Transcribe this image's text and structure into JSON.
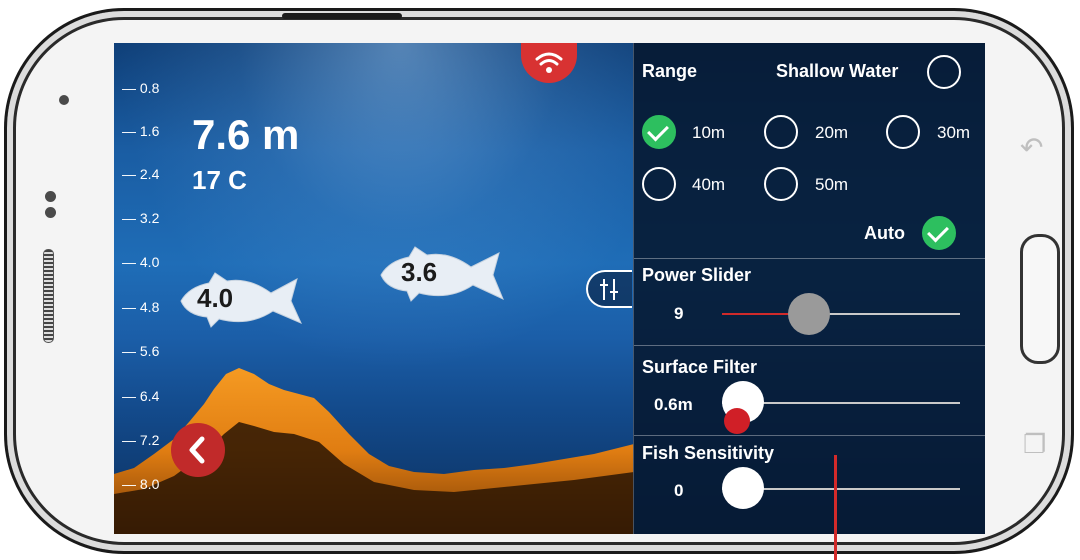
{
  "depth_scale": [
    "0.8",
    "1.6",
    "2.4",
    "3.2",
    "4.0",
    "4.8",
    "5.6",
    "6.4",
    "7.2",
    "8.0"
  ],
  "readout": {
    "depth": "7.6 m",
    "temperature": "17 C"
  },
  "fish": [
    {
      "label": "4.0"
    },
    {
      "label": "3.6"
    }
  ],
  "panel": {
    "range_title": "Range",
    "shallow_water_label": "Shallow Water",
    "shallow_water_checked": false,
    "range_options": [
      {
        "label": "10m",
        "checked": true
      },
      {
        "label": "20m",
        "checked": false
      },
      {
        "label": "30m",
        "checked": false
      },
      {
        "label": "40m",
        "checked": false
      },
      {
        "label": "50m",
        "checked": false
      }
    ],
    "auto_label": "Auto",
    "auto_checked": true,
    "power": {
      "title": "Power Slider",
      "value": "9",
      "fraction": 0.32
    },
    "surface": {
      "title": "Surface Filter",
      "value": "0.6m",
      "fraction": 0.0
    },
    "sensitivity": {
      "title": "Fish Sensitivity",
      "value": "0",
      "fraction": 0.0
    }
  },
  "icons": {
    "wifi": "wifi-icon",
    "back": "chevron-left-icon",
    "settings_toggle": "sliders-icon",
    "hw_back": "hw-back-icon",
    "hw_recents": "hw-recents-icon"
  },
  "colors": {
    "accent_red": "#d83232",
    "check_green": "#2dbf5f",
    "sonar_orange": "#e88a1c"
  }
}
